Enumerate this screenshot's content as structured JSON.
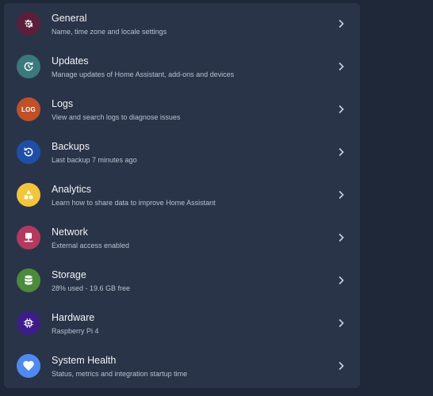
{
  "items": [
    {
      "title": "General",
      "subtitle": "Name, time zone and locale settings",
      "icon": "gear-icon",
      "color": "#5b1f3b"
    },
    {
      "title": "Updates",
      "subtitle": "Manage updates of Home Assistant, add-ons and devices",
      "icon": "update-icon",
      "color": "#3a7a7e"
    },
    {
      "title": "Logs",
      "subtitle": "View and search logs to diagnose issues",
      "icon": "log-icon",
      "color": "#c0502a",
      "icon_text": "LOG"
    },
    {
      "title": "Backups",
      "subtitle": "Last backup 7 minutes ago",
      "icon": "backup-icon",
      "color": "#1e4fa8"
    },
    {
      "title": "Analytics",
      "subtitle": "Learn how to share data to improve Home Assistant",
      "icon": "shapes-icon",
      "color": "#f2c53d"
    },
    {
      "title": "Network",
      "subtitle": "External access enabled",
      "icon": "network-icon",
      "color": "#b23a5e"
    },
    {
      "title": "Storage",
      "subtitle": "28% used - 19.6 GB free",
      "icon": "database-icon",
      "color": "#4b8b3b"
    },
    {
      "title": "Hardware",
      "subtitle": "Raspberry Pi 4",
      "icon": "chip-icon",
      "color": "#3d1d8a"
    },
    {
      "title": "System Health",
      "subtitle": "Status, metrics and integration startup time",
      "icon": "heart-icon",
      "color": "#4f8af0"
    }
  ]
}
